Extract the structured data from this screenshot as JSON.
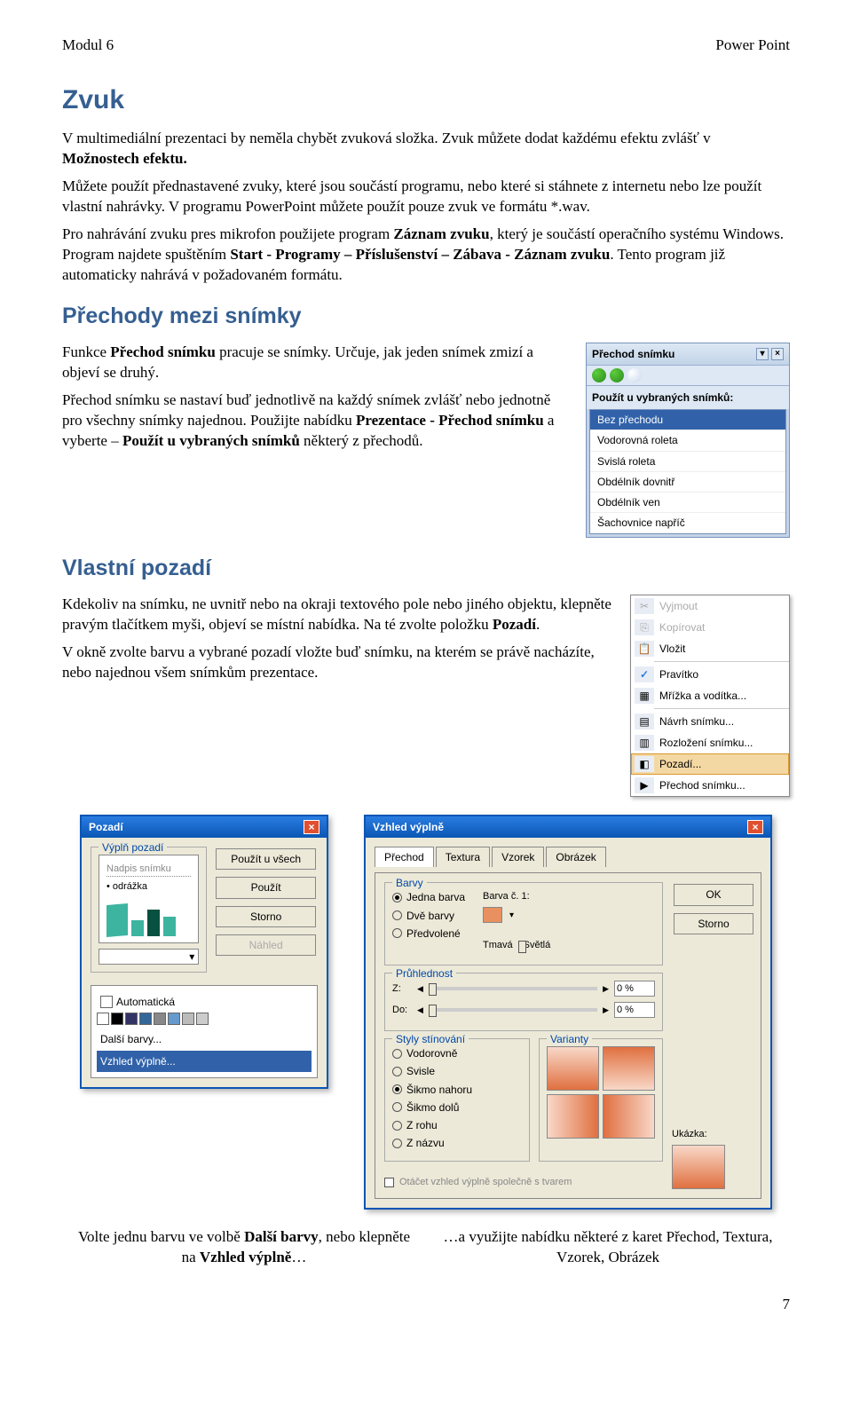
{
  "header": {
    "left": "Modul 6",
    "right": "Power Point"
  },
  "h_zvuk": "Zvuk",
  "p_zvuk_1a": "V multimediální prezentaci by neměla chybět zvuková složka. Zvuk můžete dodat každému efektu zvlášť v ",
  "p_zvuk_1b": "Možnostech efektu.",
  "p_zvuk_2": "Můžete použít přednastavené zvuky, které jsou součástí programu, nebo které si stáhnete z internetu nebo lze použít vlastní nahrávky. V programu PowerPoint můžete použít pouze zvuk ve formátu *.wav.",
  "p_zvuk_3a": "Pro nahrávání zvuku pres mikrofon použijete program ",
  "p_zvuk_3b": "Záznam zvuku",
  "p_zvuk_3c": ", který je součástí operačního systému Windows. Program najdete spuštěním ",
  "p_zvuk_3d": "Start - Programy – Příslušenství – Zábava - Záznam zvuku",
  "p_zvuk_3e": ". Tento program již automaticky nahrává v požadovaném formátu.",
  "h_prechody": "Přechody mezi snímky",
  "p_prechody_1a": "Funkce ",
  "p_prechody_1b": "Přechod snímku",
  "p_prechody_1c": " pracuje se snímky. Určuje, jak jeden snímek zmizí a objeví se druhý.",
  "p_prechody_2a": "Přechod snímku se nastaví buď jednotlivě na každý snímek zvlášť nebo jednotně pro všechny snímky najednou. Použijte nabídku ",
  "p_prechody_2b": "Prezentace - Přechod snímku",
  "p_prechody_2c": " a vyberte – ",
  "p_prechody_2d": "Použít u vybraných snímků",
  "p_prechody_2e": " některý z přechodů.",
  "taskpane": {
    "title": "Přechod snímku",
    "section": "Použít u vybraných snímků:",
    "items": [
      "Bez přechodu",
      "Vodorovná roleta",
      "Svislá roleta",
      "Obdélník dovnitř",
      "Obdélník ven",
      "Šachovnice napříč"
    ]
  },
  "h_pozadi": "Vlastní pozadí",
  "p_pozadi_1a": "Kdekoliv na snímku, ne uvnitř nebo na okraji textového pole nebo jiného objektu, klepněte pravým tlačítkem myši, objeví se místní nabídka. Na té zvolte položku ",
  "p_pozadi_1b": "Pozadí",
  "p_pozadi_1c": ".",
  "p_pozadi_2": "V okně zvolte barvu a vybrané pozadí vložte buď snímku, na kterém se právě nacházíte, nebo najednou všem snímkům prezentace.",
  "context_menu": {
    "items": [
      {
        "label": "Vyjmout",
        "disabled": true
      },
      {
        "label": "Kopírovat",
        "disabled": true
      },
      {
        "label": "Vložit"
      },
      {
        "label": "Pravítko",
        "checked": true
      },
      {
        "label": "Mřížka a vodítka..."
      },
      {
        "label": "Návrh snímku..."
      },
      {
        "label": "Rozložení snímku..."
      },
      {
        "label": "Pozadí...",
        "hover": true
      },
      {
        "label": "Přechod snímku..."
      }
    ]
  },
  "pozadi_dialog": {
    "title": "Pozadí",
    "group_label": "Výplň pozadí",
    "preview_title": "Nadpis snímku",
    "preview_bullet": "• odrážka",
    "btn_all": "Použít u všech",
    "btn_apply": "Použít",
    "btn_cancel": "Storno",
    "btn_preview": "Náhled",
    "dd_auto": "Automatická",
    "dd_more": "Další barvy...",
    "dd_fill": "Vzhled výplně..."
  },
  "vyplne_dialog": {
    "title": "Vzhled výplně",
    "tabs": [
      "Přechod",
      "Textura",
      "Vzorek",
      "Obrázek"
    ],
    "btn_ok": "OK",
    "btn_cancel": "Storno",
    "grp_barvy": "Barvy",
    "rb_jedna": "Jedna barva",
    "rb_dve": "Dvě barvy",
    "rb_pred": "Předvolené",
    "lbl_barva1": "Barva č. 1:",
    "lbl_tmava": "Tmavá",
    "lbl_svetla": "Světlá",
    "grp_pruhlednost": "Průhlednost",
    "lbl_z": "Z:",
    "lbl_do": "Do:",
    "val_pct": "0 %",
    "grp_styly": "Styly stínování",
    "rb_vodorovne": "Vodorovně",
    "rb_svisle": "Svisle",
    "rb_sikmo_nahoru": "Šikmo nahoru",
    "rb_sikmo_dolu": "Šikmo dolů",
    "rb_zrohu": "Z rohu",
    "rb_znazvu": "Z názvu",
    "grp_varianty": "Varianty",
    "lbl_ukazka": "Ukázka:",
    "cb_otacet": "Otáčet vzhled výplně společně s tvarem"
  },
  "bottom": {
    "left_a": "Volte jednu barvu ve volbě ",
    "left_b": "Další barvy",
    "left_c": ", nebo klepněte na ",
    "left_d": "Vzhled výplně",
    "left_e": "…",
    "right": "…a využijte nabídku některé z karet Přechod, Textura, Vzorek, Obrázek"
  },
  "page_number": "7"
}
